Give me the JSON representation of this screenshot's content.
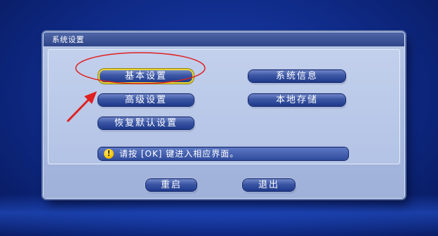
{
  "dialog": {
    "title": "系统设置"
  },
  "menu": {
    "basic": "基本设置",
    "system_info": "系统信息",
    "advanced": "高级设置",
    "local_storage": "本地存储",
    "restore_default": "恢复默认设置"
  },
  "tip": {
    "icon": "info-icon",
    "text": "请按 [OK] 键进入相应界面。"
  },
  "footer": {
    "restart": "重启",
    "exit": "退出"
  },
  "annotation": {
    "color": "#e02020"
  }
}
